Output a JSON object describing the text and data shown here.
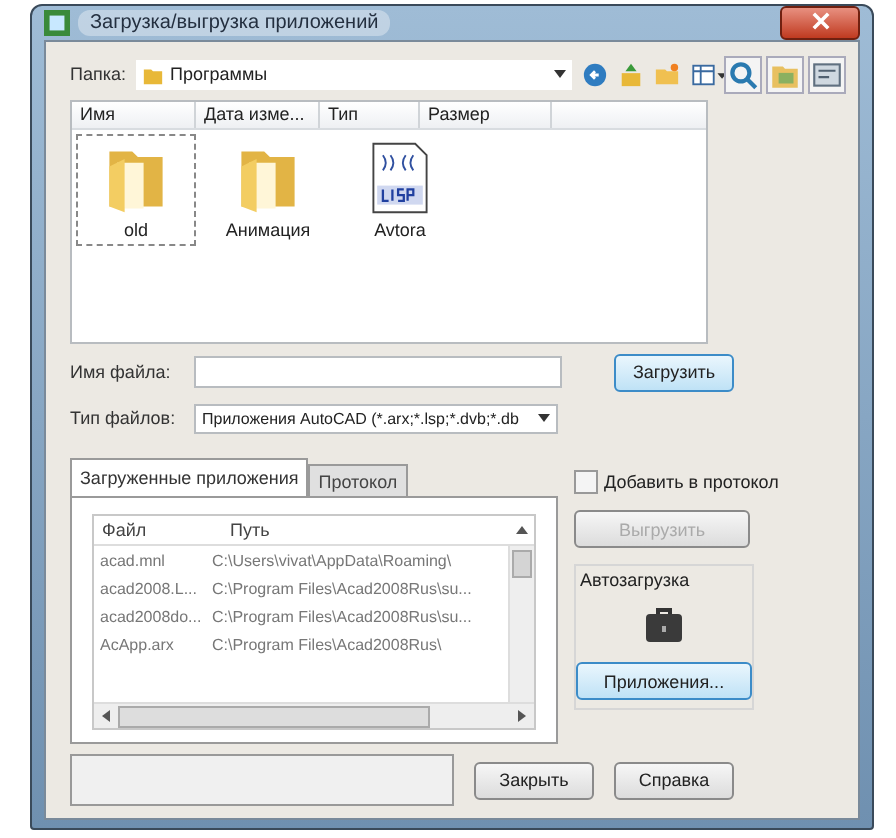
{
  "window": {
    "title": "Загрузка/выгрузка приложений"
  },
  "folder": {
    "label": "Папка:",
    "value": "Программы"
  },
  "file_list": {
    "columns": [
      "Имя",
      "Дата изме...",
      "Тип",
      "Размер"
    ],
    "items": [
      {
        "name": "old",
        "kind": "folder",
        "selected": true
      },
      {
        "name": "Анимация",
        "kind": "folder",
        "selected": false
      },
      {
        "name": "Avtora",
        "kind": "lisp",
        "selected": false
      }
    ]
  },
  "file_name": {
    "label": "Имя файла:"
  },
  "file_type": {
    "label": "Тип файлов:",
    "value": "Приложения AutoCAD (*.arx;*.lsp;*.dvb;*.db"
  },
  "load_button": "Загрузить",
  "tabs": [
    {
      "label": "Загруженные приложения",
      "selected": true
    },
    {
      "label": "Протокол",
      "selected": false
    }
  ],
  "apps_table": {
    "columns": [
      "Файл",
      "Путь"
    ],
    "rows": [
      [
        "acad.mnl",
        "C:\\Users\\vivat\\AppData\\Roaming\\"
      ],
      [
        "acad2008.L...",
        "C:\\Program Files\\Acad2008Rus\\su..."
      ],
      [
        "acad2008do...",
        "C:\\Program Files\\Acad2008Rus\\su..."
      ],
      [
        "AcApp.arx",
        "C:\\Program Files\\Acad2008Rus\\"
      ]
    ]
  },
  "add_to_log": {
    "label": "Добавить в протокол",
    "checked": false
  },
  "unload_button": {
    "label": "Выгрузить",
    "disabled": true
  },
  "autoload": {
    "title": "Автозагрузка",
    "button": "Приложения..."
  },
  "close_button": "Закрыть",
  "help_button": "Справка"
}
